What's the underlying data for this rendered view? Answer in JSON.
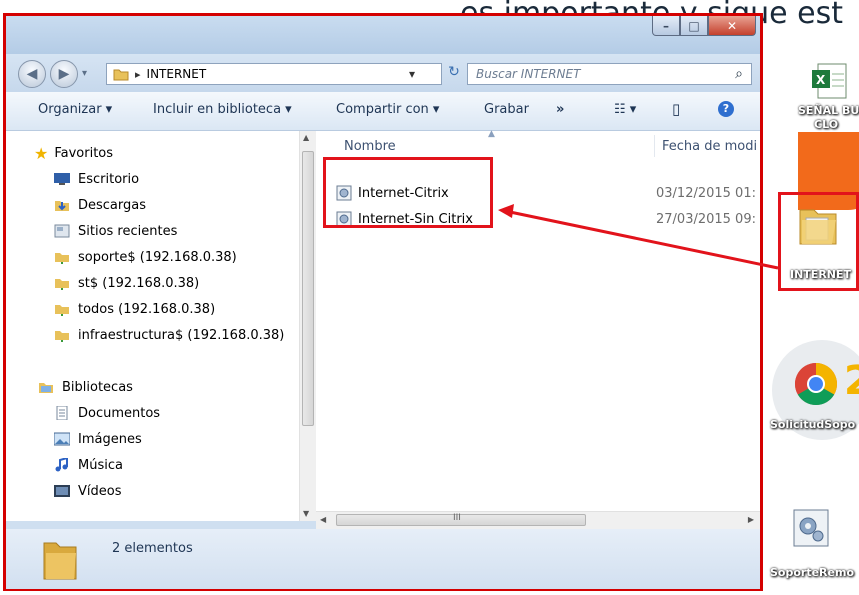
{
  "background": {
    "doc_text": "es importante y sigue est"
  },
  "window": {
    "minimize_glyph": "–",
    "maximize_glyph": "□",
    "close_glyph": "✕"
  },
  "address_bar": {
    "breadcrumb_sep": "▸",
    "path": "INTERNET",
    "dropdown_glyph": "▾",
    "refresh_glyph": "↻",
    "search_placeholder": "Buscar INTERNET",
    "search_icon_glyph": "⌕"
  },
  "toolbar": {
    "organize": "Organizar ▾",
    "include_library": "Incluir en biblioteca ▾",
    "share_with": "Compartir con ▾",
    "burn": "Grabar",
    "more": "»",
    "views_glyph": "☷ ▾",
    "preview_glyph": "▯",
    "help_glyph": "?"
  },
  "nav": {
    "favorites_title": "Favoritos",
    "favorites": [
      {
        "label": "Escritorio",
        "icon": "desktop-icon"
      },
      {
        "label": "Descargas",
        "icon": "downloads-icon"
      },
      {
        "label": "Sitios recientes",
        "icon": "recent-places-icon"
      },
      {
        "label": "soporte$ (192.168.0.38)",
        "icon": "network-folder-icon"
      },
      {
        "label": "st$ (192.168.0.38)",
        "icon": "network-folder-icon"
      },
      {
        "label": "todos (192.168.0.38)",
        "icon": "network-folder-icon"
      },
      {
        "label": "infraestructura$ (192.168.0.38)",
        "icon": "network-folder-icon"
      }
    ],
    "libraries_title": "Bibliotecas",
    "libraries": [
      {
        "label": "Documentos",
        "icon": "documents-icon"
      },
      {
        "label": "Imágenes",
        "icon": "pictures-icon"
      },
      {
        "label": "Música",
        "icon": "music-icon"
      },
      {
        "label": "Vídeos",
        "icon": "videos-icon"
      }
    ]
  },
  "files": {
    "col_name": "Nombre",
    "col_date": "Fecha de modi",
    "rows": [
      {
        "name": "Internet-Citrix",
        "date": "03/12/2015 01:"
      },
      {
        "name": "Internet-Sin Citrix",
        "date": "27/03/2015 09:"
      }
    ],
    "hscroll_grip": "III"
  },
  "status": {
    "count": "2 elementos"
  },
  "desktop": {
    "icons": [
      {
        "label": "SEÑAL BUN",
        "label2": "CLO",
        "icon": "excel-icon"
      },
      {
        "label": "INTERNET",
        "icon": "folder-icon"
      },
      {
        "label": "SolicitudSopo",
        "icon": "chrome-icon"
      },
      {
        "label": "SoporteRemo",
        "icon": "remote-support-icon"
      }
    ]
  },
  "colors": {
    "highlight_red": "#e2131b",
    "window_frame": "#cfdff0",
    "folder_yellow": "#e8c15a"
  }
}
